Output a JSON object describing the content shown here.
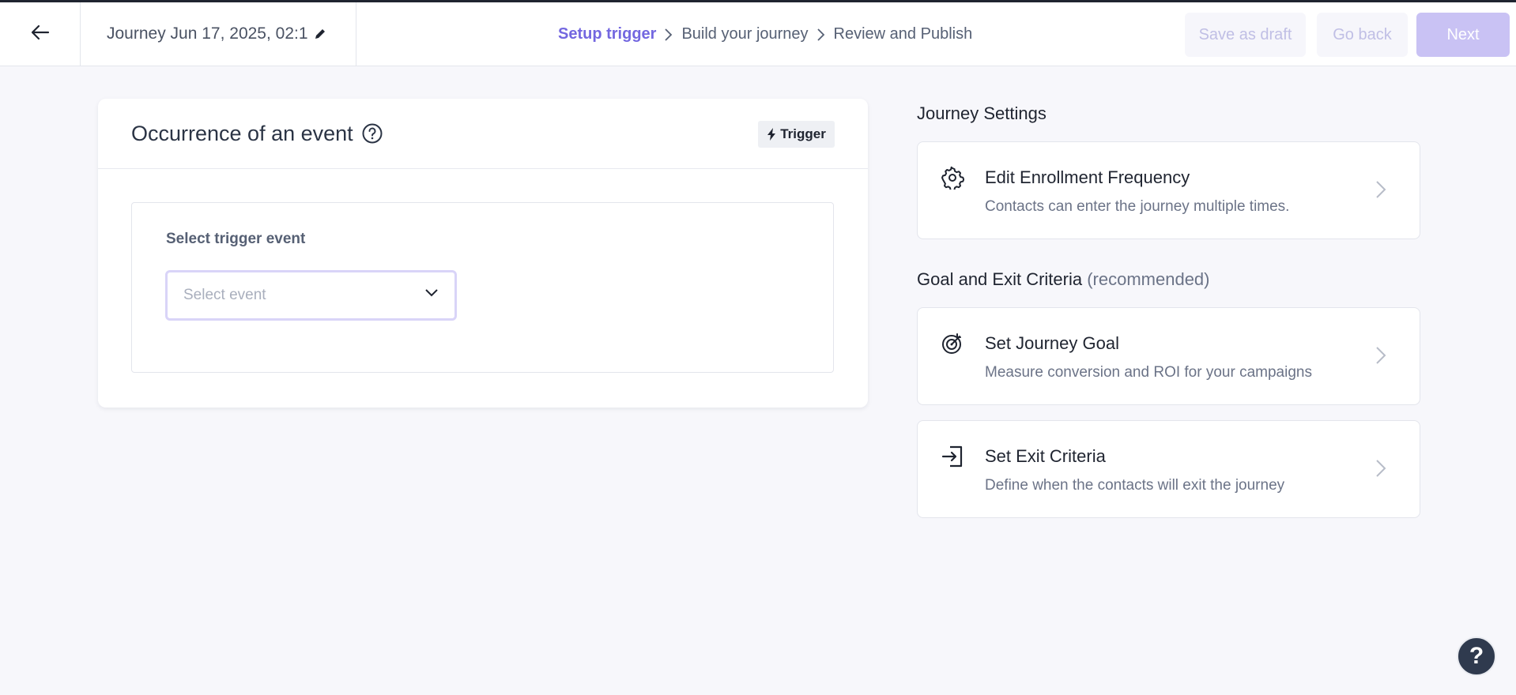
{
  "header": {
    "back_icon": "arrow-left-icon",
    "journey_title": "Journey Jun 17, 2025, 02:1",
    "edit_icon": "pencil-icon",
    "steps": [
      {
        "label": "Setup trigger",
        "active": true
      },
      {
        "label": "Build your journey",
        "active": false
      },
      {
        "label": "Review and Publish",
        "active": false
      }
    ],
    "save_draft_label": "Save as draft",
    "go_back_label": "Go back",
    "next_label": "Next"
  },
  "trigger_card": {
    "title": "Occurrence of an event",
    "badge_label": "Trigger",
    "field_label": "Select trigger event",
    "select_placeholder": "Select event"
  },
  "journey_settings": {
    "title": "Journey Settings",
    "items": [
      {
        "title": "Edit Enrollment Frequency",
        "desc": "Contacts can enter the journey multiple times.",
        "icon": "gear-icon"
      }
    ]
  },
  "goal_exit": {
    "title": "Goal and Exit Criteria",
    "subtitle": "(recommended)",
    "items": [
      {
        "title": "Set Journey Goal",
        "desc": "Measure conversion and ROI for your campaigns",
        "icon": "target-icon"
      },
      {
        "title": "Set Exit Criteria",
        "desc": "Define when the contacts will exit the journey",
        "icon": "exit-icon"
      }
    ]
  },
  "help_fab": {
    "label": "?"
  },
  "colors": {
    "accent": "#7367e0",
    "next_button": "#c9c2f4",
    "background": "#f7f7fb",
    "fab": "#2f3a4e"
  }
}
